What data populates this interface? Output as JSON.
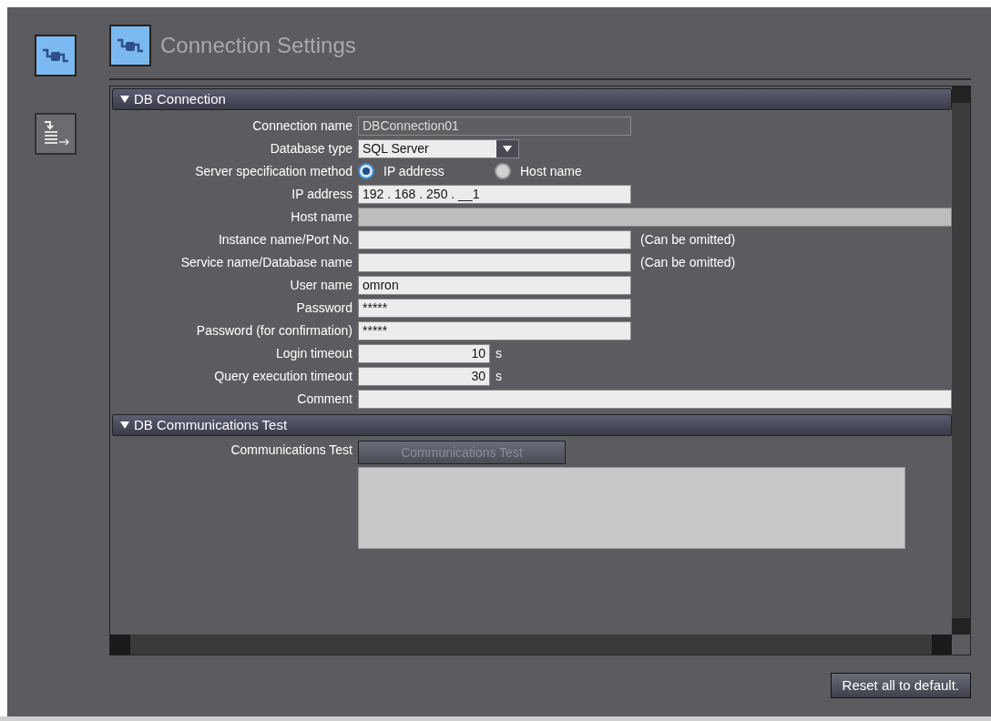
{
  "sidebar": {
    "items": [
      {
        "kind": "connection",
        "selected": true
      },
      {
        "kind": "transfer",
        "selected": false
      }
    ]
  },
  "header": {
    "title": "Connection Settings"
  },
  "sections": [
    {
      "title": "DB Connection",
      "expanded": true,
      "rows": [
        {
          "kind": "text",
          "label": "Connection name",
          "value": "DBConnection01",
          "disabled": true,
          "wide": false
        },
        {
          "kind": "select",
          "label": "Database type",
          "value": "SQL Server"
        },
        {
          "kind": "radio",
          "label": "Server specification method",
          "options": [
            {
              "label": "IP address",
              "selected": true
            },
            {
              "label": "Host name",
              "selected": false
            }
          ]
        },
        {
          "kind": "text",
          "label": "IP address",
          "value": "192 . 168 . 250 . __1",
          "disabled": false,
          "wide": false
        },
        {
          "kind": "text",
          "label": "Host name",
          "disabled": true,
          "wide": true
        },
        {
          "kind": "text",
          "label": "Instance name/Port No.",
          "disabled": false,
          "wide": false,
          "note": "(Can be omitted)"
        },
        {
          "kind": "text",
          "label": "Service name/Database name",
          "disabled": false,
          "wide": false,
          "note": "(Can be omitted)"
        },
        {
          "kind": "text",
          "label": "User name",
          "value": "omron",
          "disabled": false,
          "wide": false
        },
        {
          "kind": "text",
          "label": "Password",
          "value": "*****",
          "disabled": false,
          "wide": false
        },
        {
          "kind": "text",
          "label": "Password (for confirmation)",
          "value": "*****",
          "disabled": false,
          "wide": false
        },
        {
          "kind": "number",
          "label": "Login timeout",
          "value": "10",
          "unit": "s"
        },
        {
          "kind": "number",
          "label": "Query execution timeout",
          "value": "30",
          "unit": "s"
        },
        {
          "kind": "text",
          "label": "Comment",
          "disabled": false,
          "wide": true
        }
      ]
    },
    {
      "title": "DB Communications Test",
      "expanded": true,
      "rows": [
        {
          "kind": "test",
          "label": "Communications Test",
          "button": "Communications Test",
          "disabled": true
        }
      ]
    }
  ],
  "footer": {
    "button": "Reset all to default."
  }
}
